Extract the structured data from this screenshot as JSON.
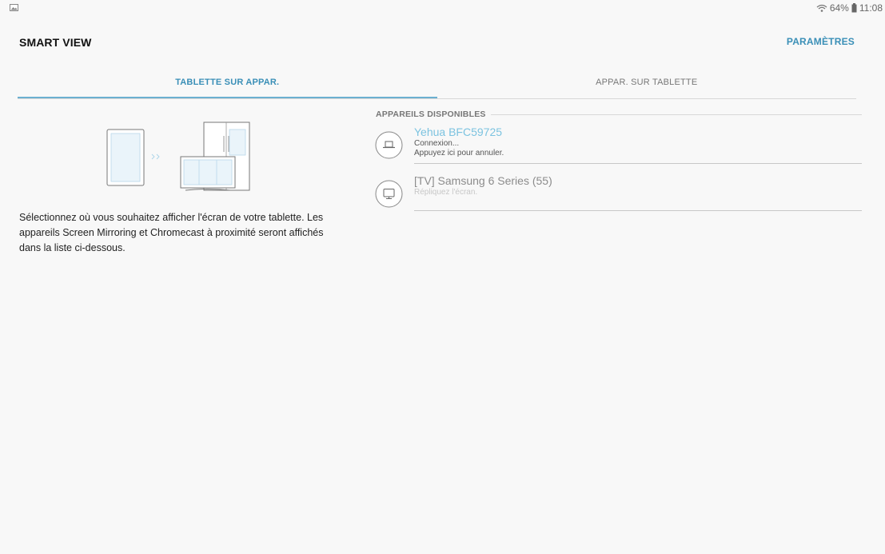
{
  "status_bar": {
    "battery_text": "64%",
    "time": "11:08",
    "icons": [
      "image-notification-icon",
      "wifi-icon",
      "battery-icon"
    ]
  },
  "app_bar": {
    "title": "SMART VIEW",
    "settings_label": "PARAMÈTRES"
  },
  "tabs": [
    {
      "label": "TABLETTE SUR APPAR.",
      "active": true
    },
    {
      "label": "APPAR. SUR TABLETTE",
      "active": false
    }
  ],
  "intro": {
    "text": "Sélectionnez où vous souhaitez afficher l'écran de votre tablette. Les appareils Screen Mirroring et Chromecast à proximité seront affichés dans la liste ci-dessous."
  },
  "devices_section": {
    "header": "APPAREILS DISPONIBLES",
    "items": [
      {
        "name": "Yehua BFC59725",
        "line1": "Connexion...",
        "line2": "Appuyez ici pour annuler.",
        "icon": "media-receiver-icon",
        "status": "connecting"
      },
      {
        "name": "[TV] Samsung 6 Series (55)",
        "line1": "Répliquez l'écran.",
        "icon": "tv-icon",
        "status": "idle"
      }
    ]
  },
  "colors": {
    "accent": "#3a8fb7",
    "connecting": "#7cc3e0",
    "background": "#f8f8f8"
  }
}
